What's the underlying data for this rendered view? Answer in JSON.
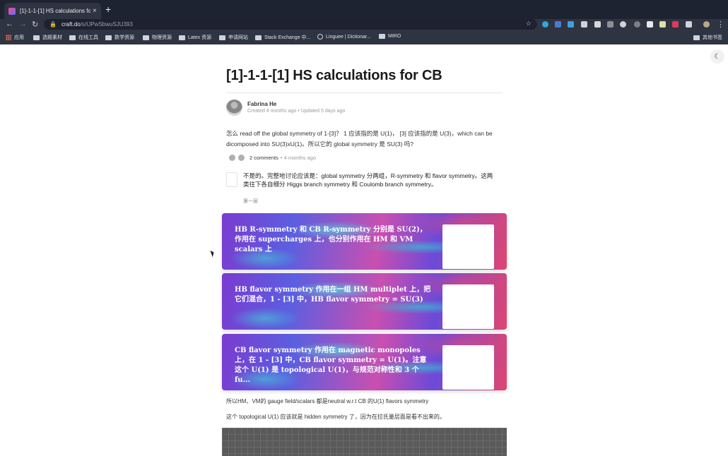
{
  "browser": {
    "tab_title": "[1]-1-1-[1] HS calculations for",
    "tab_close": "×",
    "new_tab": "+",
    "url_host": "craft.do",
    "url_path": "/s/IJPwSbwuSJU393",
    "bookmarks": [
      "应用",
      "选题素材",
      "在线工具",
      "数学资源",
      "物理资源",
      "Latex 资源",
      "申请网站",
      "Stack Exchange 中...",
      "Linguee | Dictionar...",
      "MIRO"
    ],
    "other_bookmarks": "其他书签"
  },
  "doc": {
    "title": "[1]-1-1-[1] HS calculations for CB",
    "author": "Fabrina He",
    "meta": "Created 4 months ago  •  Updated 5 days ago",
    "question": "怎么 read off the global symmetry of 1-[3]？ 1 应该指的是 U(1)， [3] 应该指的是 U(3)，which can be dicomposed into SU(3)xU(1)。所以它的 global symmetry 是 SU(3) 吗?",
    "comments_count": "2 comments",
    "comments_ago": "•  4 months ago",
    "answer": "不是的。完整地讨论应该是：global symmetry 分两组，R-symmetry 和 flavor symmetry。这两类往下各自细分 Higgs branch symmetry 和 Coulomb branch symmetry。",
    "answer_sub": "第一层",
    "cards": [
      "HB R-symmetry 和 CB R-symmetry 分别是 SU(2)，作用在 supercharges 上，也分别作用在 HM 和 VM scalars 上",
      "HB flavor symmetry 作用在一组 HM multiplet 上，把它们混合，1 - [3] 中，HB flavor symmetry = SU(3)",
      "CB flavor symmetry 作用在 magnetic monopoles 上，在 1 - [3] 中，CB flavor symmetry = U(1)。注意这个 U(1) 是 topological U(1)，与规范对称性和 3 个 fu..."
    ],
    "note1": "所以HM、VM的 gauge field/scalars 都是neutral w.r.t CB 的U(1) flavors symmetry",
    "note2": "这个 topological U(1) 应该就是 hidden symmetry 了，因为在拉氏量层面是看不出来的。"
  }
}
